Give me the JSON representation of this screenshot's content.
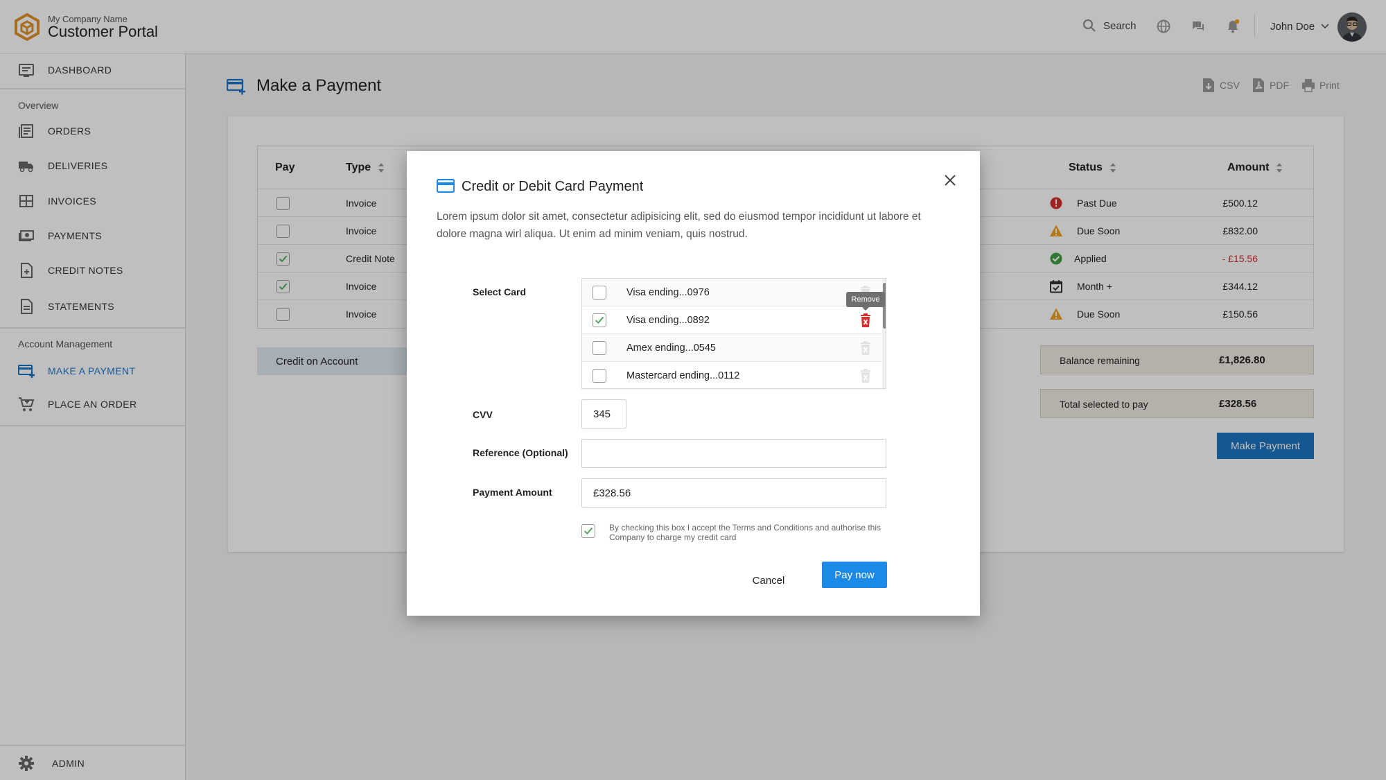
{
  "brand": {
    "company": "My Company Name",
    "portal": "Customer Portal"
  },
  "topbar": {
    "search_label": "Search",
    "user_name": "John Doe"
  },
  "colors": {
    "accent": "#1a73c9",
    "button_primary": "#1b8ae8",
    "logo": "#e0922a",
    "danger": "#d32f2f",
    "warning": "#f0a020",
    "success": "#43a047",
    "negative_amount": "#d32f2f"
  },
  "sidebar": {
    "dashboard": "DASHBOARD",
    "overview_label": "Overview",
    "items": [
      {
        "label": "ORDERS",
        "icon": "orders-icon"
      },
      {
        "label": "DELIVERIES",
        "icon": "truck-icon"
      },
      {
        "label": "INVOICES",
        "icon": "invoice-grid-icon"
      },
      {
        "label": "PAYMENTS",
        "icon": "cash-icon"
      },
      {
        "label": "CREDIT NOTES",
        "icon": "credit-note-icon"
      },
      {
        "label": "STATEMENTS",
        "icon": "statement-icon"
      }
    ],
    "account_label": "Account Management",
    "account_items": [
      {
        "label": "MAKE A PAYMENT",
        "icon": "card-plus-icon",
        "active": true
      },
      {
        "label": "PLACE AN ORDER",
        "icon": "cart-icon"
      }
    ],
    "admin": "ADMIN"
  },
  "page": {
    "title": "Make a Payment",
    "exports": {
      "csv": "CSV",
      "pdf": "PDF",
      "print": "Print"
    }
  },
  "table": {
    "headers": {
      "pay": "Pay",
      "type": "Type",
      "status": "Status",
      "amount": "Amount"
    },
    "rows": [
      {
        "type": "Invoice",
        "checked": false,
        "status": "Past Due",
        "status_icon": "error-icon",
        "amount": "£500.12"
      },
      {
        "type": "Invoice",
        "checked": false,
        "status": "Due Soon",
        "status_icon": "warning-icon",
        "amount": "£832.00"
      },
      {
        "type": "Credit Note",
        "checked": true,
        "status": "Applied",
        "status_icon": "check-circle-icon",
        "amount": "- £15.56"
      },
      {
        "type": "Invoice",
        "checked": true,
        "status": "Month +",
        "status_icon": "calendar-check-icon",
        "amount": "£344.12"
      },
      {
        "type": "Invoice",
        "checked": false,
        "status": "Due Soon",
        "status_icon": "warning-icon",
        "amount": "£150.56"
      }
    ]
  },
  "credit_on_account": "Credit on Account",
  "summary": {
    "balance_label": "Balance remaining",
    "balance_value": "£1,826.80",
    "total_label": "Total selected to pay",
    "total_value": "£328.56",
    "make_payment": "Make Payment"
  },
  "modal": {
    "title": "Credit or Debit Card Payment",
    "description": "Lorem ipsum dolor sit amet, consectetur adipisicing elit, sed do eiusmod tempor incididunt ut labore et dolore magna wirl aliqua. Ut enim ad minim veniam, quis nostrud.",
    "select_card_label": "Select Card",
    "cards": [
      {
        "name": "Visa ending...0976",
        "checked": false
      },
      {
        "name": "Visa ending...0892",
        "checked": true
      },
      {
        "name": "Amex ending...0545",
        "checked": false
      },
      {
        "name": "Mastercard ending...0112",
        "checked": false
      }
    ],
    "remove_tooltip": "Remove",
    "cvv_label": "CVV",
    "cvv_value": "345",
    "reference_label": "Reference (Optional)",
    "reference_value": "",
    "amount_label": "Payment Amount",
    "amount_value": "£328.56",
    "terms_checked": true,
    "terms_text": "By checking this box I accept the Terms and Conditions and authorise this Company to charge my credit card",
    "cancel": "Cancel",
    "pay_now": "Pay now"
  }
}
